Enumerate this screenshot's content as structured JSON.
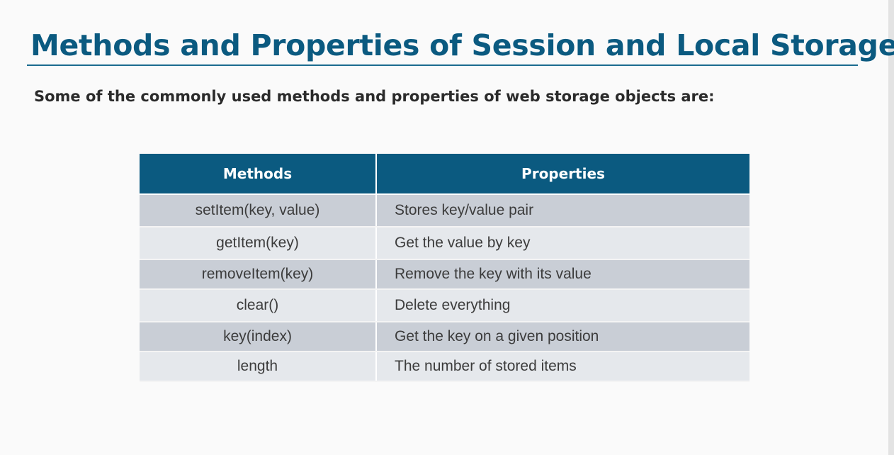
{
  "slide": {
    "title": "Methods and Properties of Session and Local Storage",
    "subtitle": "Some of the commonly used methods and properties of web storage objects are:"
  },
  "table": {
    "headers": {
      "methods": "Methods",
      "properties": "Properties"
    },
    "rows": [
      {
        "method": "setItem(key, value)",
        "property": "Stores key/value pair"
      },
      {
        "method": "getItem(key)",
        "property": "Get the value by key"
      },
      {
        "method": "removeItem(key)",
        "property": "Remove the key with its value"
      },
      {
        "method": "clear()",
        "property": "Delete everything"
      },
      {
        "method": "key(index)",
        "property": "Get the key on a given position"
      },
      {
        "method": "length",
        "property": "The number of stored items"
      }
    ]
  },
  "colors": {
    "accent": "#0b5a80",
    "row_dark": "#c9ced6",
    "row_light": "#e5e8ec"
  }
}
